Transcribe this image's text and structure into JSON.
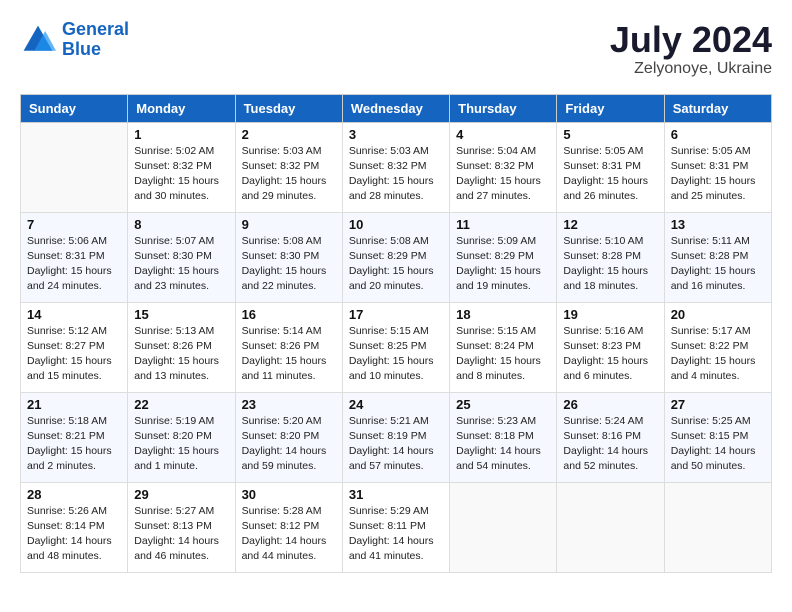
{
  "logo": {
    "line1": "General",
    "line2": "Blue"
  },
  "title": "July 2024",
  "location": "Zelyonoye, Ukraine",
  "days_header": [
    "Sunday",
    "Monday",
    "Tuesday",
    "Wednesday",
    "Thursday",
    "Friday",
    "Saturday"
  ],
  "weeks": [
    [
      {
        "day": "",
        "info": ""
      },
      {
        "day": "1",
        "info": "Sunrise: 5:02 AM\nSunset: 8:32 PM\nDaylight: 15 hours\nand 30 minutes."
      },
      {
        "day": "2",
        "info": "Sunrise: 5:03 AM\nSunset: 8:32 PM\nDaylight: 15 hours\nand 29 minutes."
      },
      {
        "day": "3",
        "info": "Sunrise: 5:03 AM\nSunset: 8:32 PM\nDaylight: 15 hours\nand 28 minutes."
      },
      {
        "day": "4",
        "info": "Sunrise: 5:04 AM\nSunset: 8:32 PM\nDaylight: 15 hours\nand 27 minutes."
      },
      {
        "day": "5",
        "info": "Sunrise: 5:05 AM\nSunset: 8:31 PM\nDaylight: 15 hours\nand 26 minutes."
      },
      {
        "day": "6",
        "info": "Sunrise: 5:05 AM\nSunset: 8:31 PM\nDaylight: 15 hours\nand 25 minutes."
      }
    ],
    [
      {
        "day": "7",
        "info": "Sunrise: 5:06 AM\nSunset: 8:31 PM\nDaylight: 15 hours\nand 24 minutes."
      },
      {
        "day": "8",
        "info": "Sunrise: 5:07 AM\nSunset: 8:30 PM\nDaylight: 15 hours\nand 23 minutes."
      },
      {
        "day": "9",
        "info": "Sunrise: 5:08 AM\nSunset: 8:30 PM\nDaylight: 15 hours\nand 22 minutes."
      },
      {
        "day": "10",
        "info": "Sunrise: 5:08 AM\nSunset: 8:29 PM\nDaylight: 15 hours\nand 20 minutes."
      },
      {
        "day": "11",
        "info": "Sunrise: 5:09 AM\nSunset: 8:29 PM\nDaylight: 15 hours\nand 19 minutes."
      },
      {
        "day": "12",
        "info": "Sunrise: 5:10 AM\nSunset: 8:28 PM\nDaylight: 15 hours\nand 18 minutes."
      },
      {
        "day": "13",
        "info": "Sunrise: 5:11 AM\nSunset: 8:28 PM\nDaylight: 15 hours\nand 16 minutes."
      }
    ],
    [
      {
        "day": "14",
        "info": "Sunrise: 5:12 AM\nSunset: 8:27 PM\nDaylight: 15 hours\nand 15 minutes."
      },
      {
        "day": "15",
        "info": "Sunrise: 5:13 AM\nSunset: 8:26 PM\nDaylight: 15 hours\nand 13 minutes."
      },
      {
        "day": "16",
        "info": "Sunrise: 5:14 AM\nSunset: 8:26 PM\nDaylight: 15 hours\nand 11 minutes."
      },
      {
        "day": "17",
        "info": "Sunrise: 5:15 AM\nSunset: 8:25 PM\nDaylight: 15 hours\nand 10 minutes."
      },
      {
        "day": "18",
        "info": "Sunrise: 5:15 AM\nSunset: 8:24 PM\nDaylight: 15 hours\nand 8 minutes."
      },
      {
        "day": "19",
        "info": "Sunrise: 5:16 AM\nSunset: 8:23 PM\nDaylight: 15 hours\nand 6 minutes."
      },
      {
        "day": "20",
        "info": "Sunrise: 5:17 AM\nSunset: 8:22 PM\nDaylight: 15 hours\nand 4 minutes."
      }
    ],
    [
      {
        "day": "21",
        "info": "Sunrise: 5:18 AM\nSunset: 8:21 PM\nDaylight: 15 hours\nand 2 minutes."
      },
      {
        "day": "22",
        "info": "Sunrise: 5:19 AM\nSunset: 8:20 PM\nDaylight: 15 hours\nand 1 minute."
      },
      {
        "day": "23",
        "info": "Sunrise: 5:20 AM\nSunset: 8:20 PM\nDaylight: 14 hours\nand 59 minutes."
      },
      {
        "day": "24",
        "info": "Sunrise: 5:21 AM\nSunset: 8:19 PM\nDaylight: 14 hours\nand 57 minutes."
      },
      {
        "day": "25",
        "info": "Sunrise: 5:23 AM\nSunset: 8:18 PM\nDaylight: 14 hours\nand 54 minutes."
      },
      {
        "day": "26",
        "info": "Sunrise: 5:24 AM\nSunset: 8:16 PM\nDaylight: 14 hours\nand 52 minutes."
      },
      {
        "day": "27",
        "info": "Sunrise: 5:25 AM\nSunset: 8:15 PM\nDaylight: 14 hours\nand 50 minutes."
      }
    ],
    [
      {
        "day": "28",
        "info": "Sunrise: 5:26 AM\nSunset: 8:14 PM\nDaylight: 14 hours\nand 48 minutes."
      },
      {
        "day": "29",
        "info": "Sunrise: 5:27 AM\nSunset: 8:13 PM\nDaylight: 14 hours\nand 46 minutes."
      },
      {
        "day": "30",
        "info": "Sunrise: 5:28 AM\nSunset: 8:12 PM\nDaylight: 14 hours\nand 44 minutes."
      },
      {
        "day": "31",
        "info": "Sunrise: 5:29 AM\nSunset: 8:11 PM\nDaylight: 14 hours\nand 41 minutes."
      },
      {
        "day": "",
        "info": ""
      },
      {
        "day": "",
        "info": ""
      },
      {
        "day": "",
        "info": ""
      }
    ]
  ]
}
